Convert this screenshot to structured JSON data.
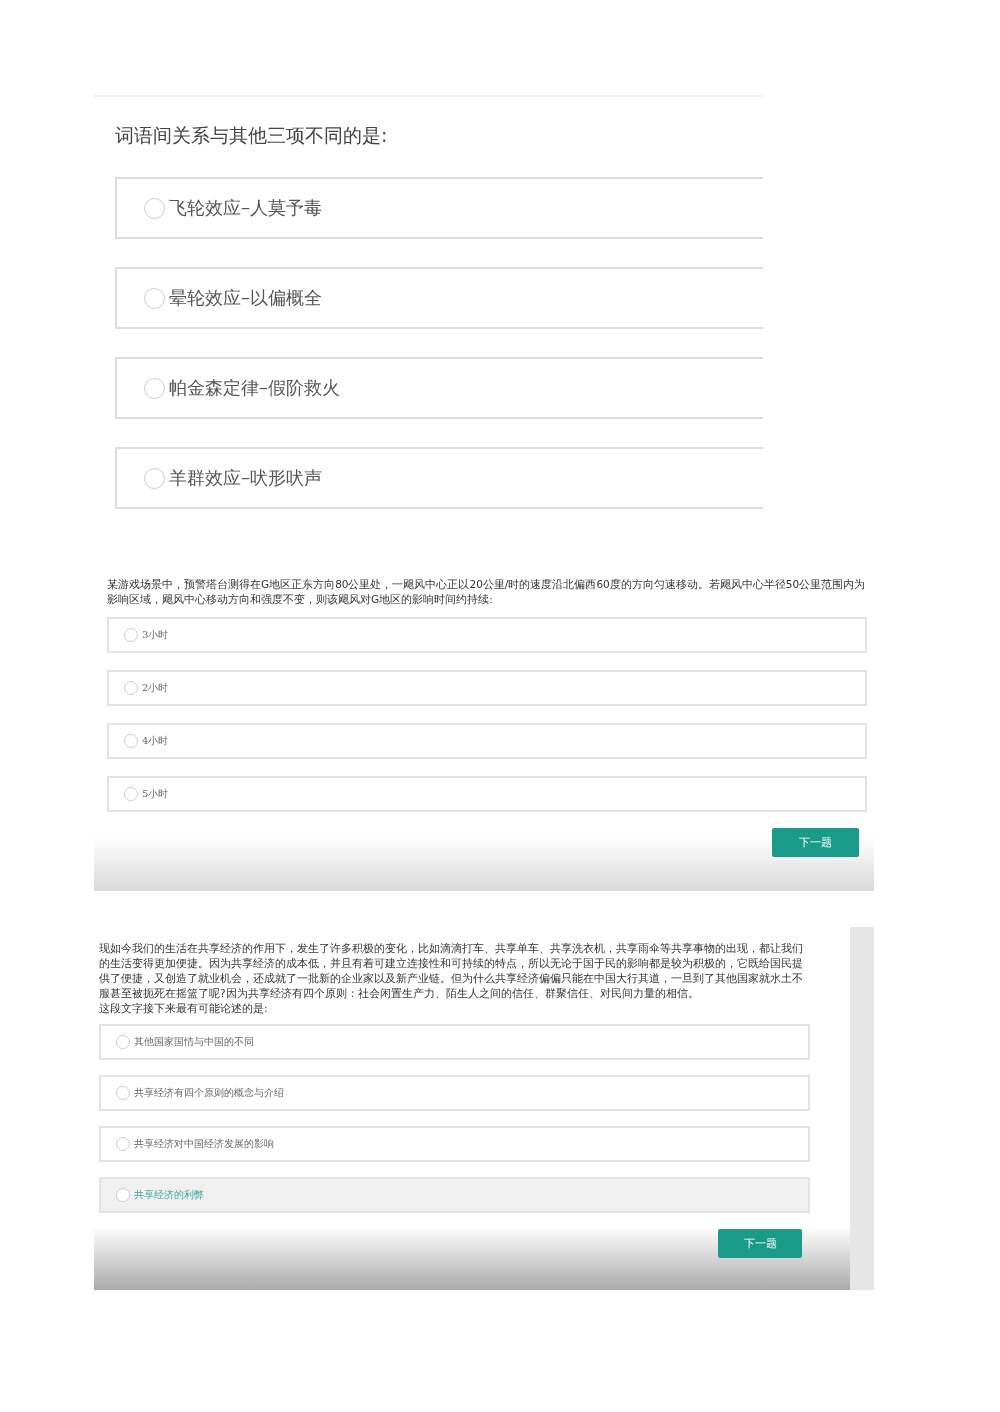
{
  "panels": [
    {
      "kind": "wide",
      "question": "词语间关系与其他三项不同的是:",
      "options": [
        {
          "label": "飞轮效应–人莫予毒",
          "selected": false,
          "highlighted": false
        },
        {
          "label": "晕轮效应–以偏概全",
          "selected": false,
          "highlighted": false
        },
        {
          "label": "帕金森定律–假阶救火",
          "selected": false,
          "highlighted": false
        },
        {
          "label": "羊群效应–吠形吠声",
          "selected": false,
          "highlighted": false
        }
      ]
    },
    {
      "kind": "compact",
      "question": "某游戏场景中，预警塔台测得在G地区正东方向80公里处，一飓风中心正以20公里/时的速度沿北偏西60度的方向匀速移动。若飓风中心半径50公里范围内为影响区域，飓风中心移动方向和强度不变，则该飓风对G地区的影响时间约持续:",
      "options": [
        {
          "label": "3小时",
          "selected": false,
          "highlighted": false
        },
        {
          "label": "2小时",
          "selected": false,
          "highlighted": false
        },
        {
          "label": "4小时",
          "selected": false,
          "highlighted": false
        },
        {
          "label": "5小时",
          "selected": false,
          "highlighted": false
        }
      ],
      "button": "下一题"
    },
    {
      "kind": "scroll",
      "question": "现如今我们的生活在共享经济的作用下，发生了许多积极的变化，比如滴滴打车、共享单车、共享洗衣机，共享雨伞等共享事物的出现，都让我们的生活变得更加便捷。因为共享经济的成本低，并且有着可建立连接性和可持续的特点，所以无论于国于民的影响都是较为积极的，它既给国民提供了便捷，又创造了就业机会，还成就了一批新的企业家以及新产业链。但为什么共享经济偏偏只能在中国大行其道，一旦到了其他国家就水土不服甚至被扼死在摇篮了呢?因为共享经济有四个原则：社会闲置生产力、陌生人之间的信任、群聚信任、对民间力量的相信。",
      "prompt": "这段文字接下来最有可能论述的是:",
      "options": [
        {
          "label": "其他国家国情与中国的不同",
          "selected": false,
          "highlighted": false
        },
        {
          "label": "共享经济有四个原则的概念与介绍",
          "selected": false,
          "highlighted": false
        },
        {
          "label": "共享经济对中国经济发展的影响",
          "selected": false,
          "highlighted": false
        },
        {
          "label": "共享经济的利弊",
          "selected": false,
          "highlighted": true
        }
      ],
      "button": "下一题"
    }
  ]
}
